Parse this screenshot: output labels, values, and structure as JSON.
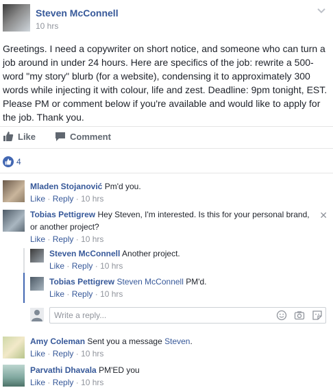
{
  "post": {
    "author": "Steven McConnell",
    "time": "10 hrs",
    "text": "Greetings. I need a copywriter on short notice, and someone who can turn a job around in under 24 hours. Here are specifics of the job: rewrite a 500-word \"my story\" blurb (for a website), condensing it to approximately 300 words while injecting it with colour, life and zest. Deadline: 9pm tonight, EST. Please PM or comment below if you're available and would like to apply for the job. Thank you."
  },
  "actions": {
    "like": "Like",
    "comment": "Comment"
  },
  "reactions": {
    "count": "4"
  },
  "meta": {
    "like": "Like",
    "reply": "Reply",
    "sep": "·"
  },
  "comments": [
    {
      "name": "Mladen Stojanović",
      "text": "Pm'd you.",
      "time": "10 hrs"
    },
    {
      "name": "Tobias Pettigrew",
      "text": "Hey Steven, I'm interested. Is this for your personal brand, or another project?",
      "time": "10 hrs"
    },
    {
      "name": "Steven McConnell",
      "text": "Another project.",
      "time": "10 hrs"
    },
    {
      "name": "Tobias Pettigrew",
      "mention": "Steven McConnell",
      "text": "PM'd.",
      "time": "10 hrs"
    },
    {
      "name": "Amy Coleman",
      "text_pre": "Sent you a message",
      "mention": "Steven",
      "text_post": ".",
      "time": "10 hrs"
    },
    {
      "name": "Parvathi Dhavala",
      "text": "PM'ED you",
      "time": "10 hrs"
    }
  ],
  "reply": {
    "placeholder": "Write a reply..."
  },
  "icons": [
    "chevron-down-icon",
    "thumbs-up-icon",
    "comment-icon",
    "like-badge-icon",
    "close-icon",
    "emoji-icon",
    "camera-icon",
    "sticker-icon"
  ],
  "colors": {
    "link": "#365899",
    "meta": "#90949c",
    "text": "#1d2129",
    "like_blue": "#4267b2"
  }
}
